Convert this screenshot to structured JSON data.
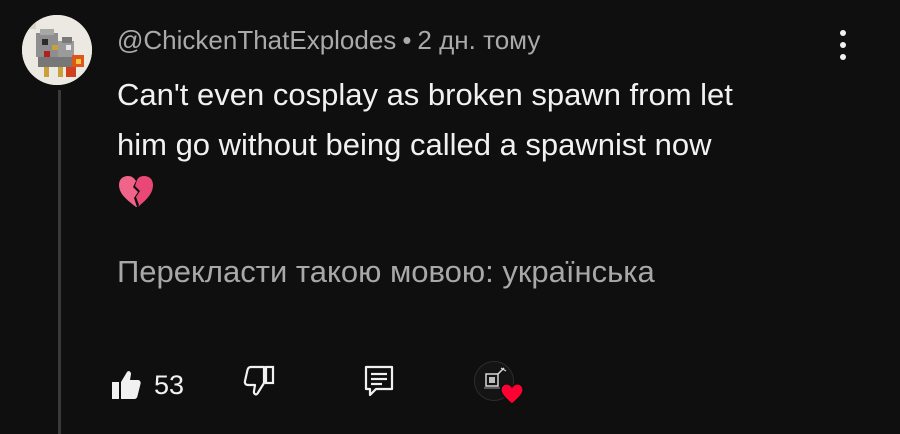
{
  "comment": {
    "author": "@ChickenThatExplodes",
    "separator": "•",
    "timestamp": "2 дн. тому",
    "text": "Can't even cosplay as broken spawn from let\nhim go without being called a spawnist now",
    "emoji_icon": "broken-heart-icon"
  },
  "translate": {
    "label": "Перекласти такою мовою: українська"
  },
  "actions": {
    "like_count": "53",
    "like_icon": "thumbs-up-filled-icon",
    "dislike_icon": "thumbs-down-icon",
    "reply_icon": "reply-comment-icon",
    "creator_heart_icon": "creator-heart-icon",
    "heart_color": "#ff0033"
  },
  "menu": {
    "icon": "more-vertical-icon"
  },
  "colors": {
    "background": "#0f0f0f",
    "primary_text": "#f1f1f1",
    "secondary_text": "#aaaaaa"
  }
}
